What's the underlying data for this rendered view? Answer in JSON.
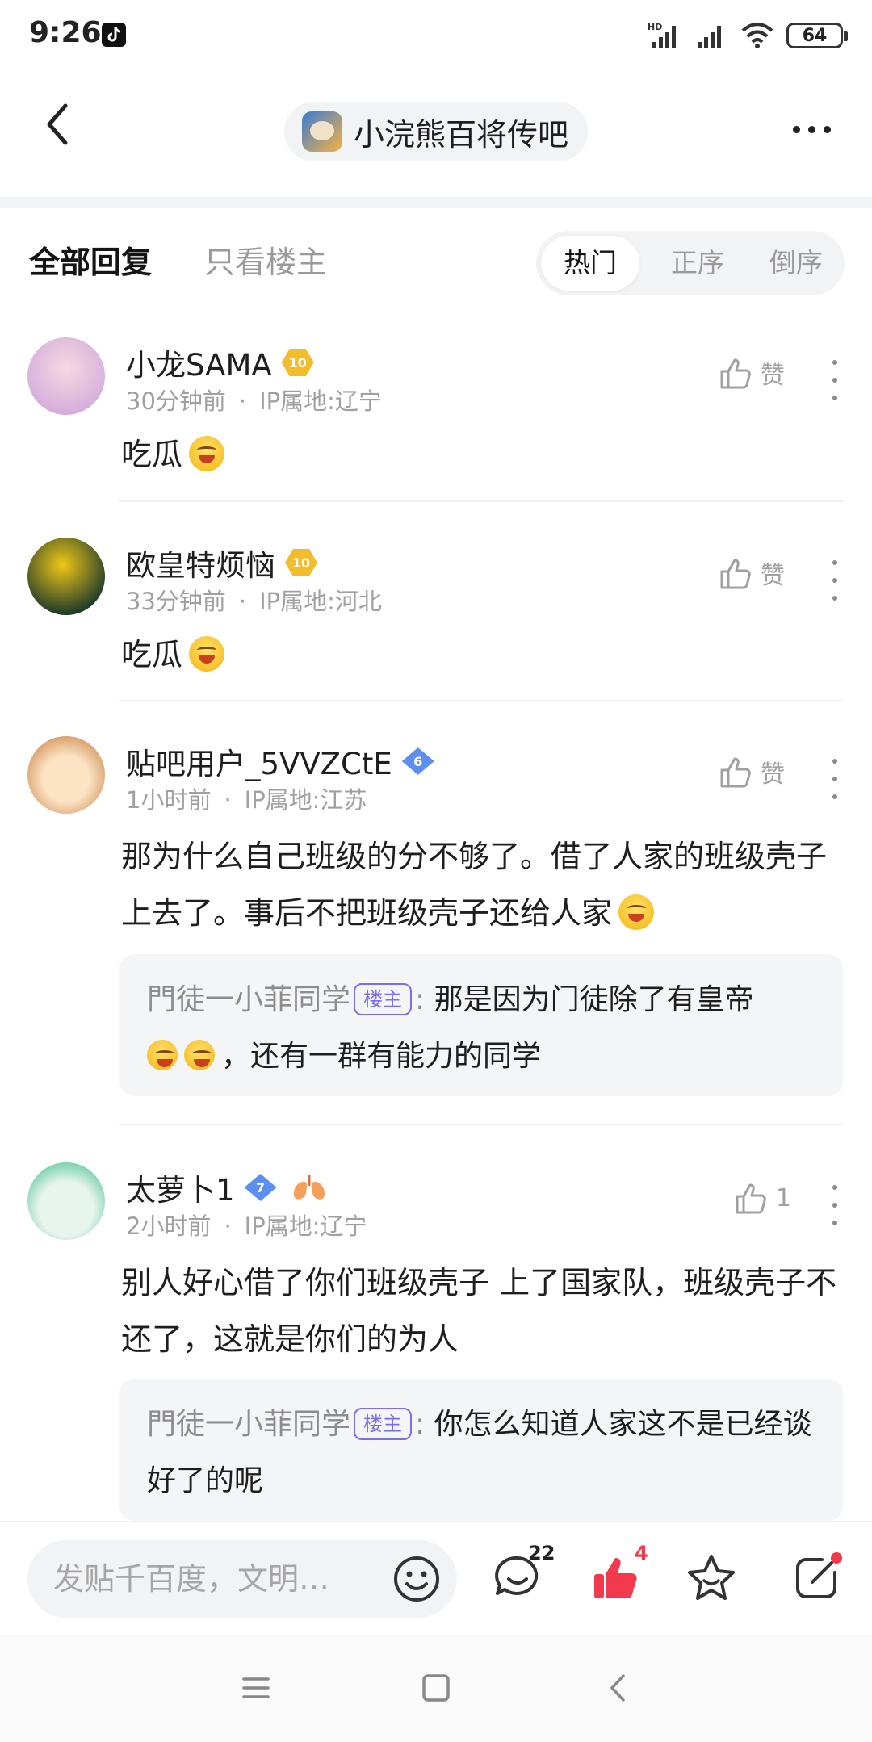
{
  "status_bar": {
    "time": "9:26",
    "battery": "64"
  },
  "header": {
    "forum_name": "小浣熊百将传吧"
  },
  "filters": {
    "tab_all": "全部回复",
    "tab_op_only": "只看楼主",
    "sort_hot": "热门",
    "sort_asc": "正序",
    "sort_desc": "倒序"
  },
  "comments": [
    {
      "username": "小龙SAMA",
      "level": "10",
      "time": "30分钟前",
      "ip": "IP属地:辽宁",
      "like_label": "赞",
      "text": "吃瓜",
      "avatar_colors": [
        "#f7d8e0",
        "#c9a0dc"
      ]
    },
    {
      "username": "欧皇特烦恼",
      "level": "10",
      "time": "33分钟前",
      "ip": "IP属地:河北",
      "like_label": "赞",
      "text": "吃瓜",
      "avatar_colors": [
        "#f0c817",
        "#1f3b2a"
      ]
    },
    {
      "username": "贴吧用户_5VVZCtE",
      "level": "6",
      "time": "1小时前",
      "ip": "IP属地:江苏",
      "like_label": "赞",
      "text": "那为什么自己班级的分不够了。借了人家的班级壳子上去了。事后不把班级壳子还给人家",
      "reply": {
        "author": "門徒一小菲同学",
        "tag": "楼主",
        "text_before": "那是因为门徒除了有皇帝",
        "text_after": "，还有一群有能力的同学"
      },
      "avatar_colors": [
        "#fbe3c4",
        "#d9a06b"
      ]
    },
    {
      "username": "太萝卜1",
      "level": "7",
      "time": "2小时前",
      "ip": "IP属地:辽宁",
      "like_label": "1",
      "text": "别人好心借了你们班级壳子 上了国家队，班级壳子不还了，这就是你们的为人",
      "reply": {
        "author": "門徒一小菲同学",
        "tag": "楼主",
        "text": "你怎么知道人家这不是已经谈好了的呢"
      },
      "avatar_colors": [
        "#e8f4ee",
        "#6fcfa8"
      ]
    }
  ],
  "bottom_bar": {
    "input_placeholder": "发贴千百度，文明…",
    "comment_count": "22",
    "like_count": "4"
  },
  "colors": {
    "accent_red": "#f23a4f",
    "op_tag": "#7b6cf0",
    "gold_badge": "#f3bc2b",
    "blue_badge": "#5c8ff0"
  }
}
